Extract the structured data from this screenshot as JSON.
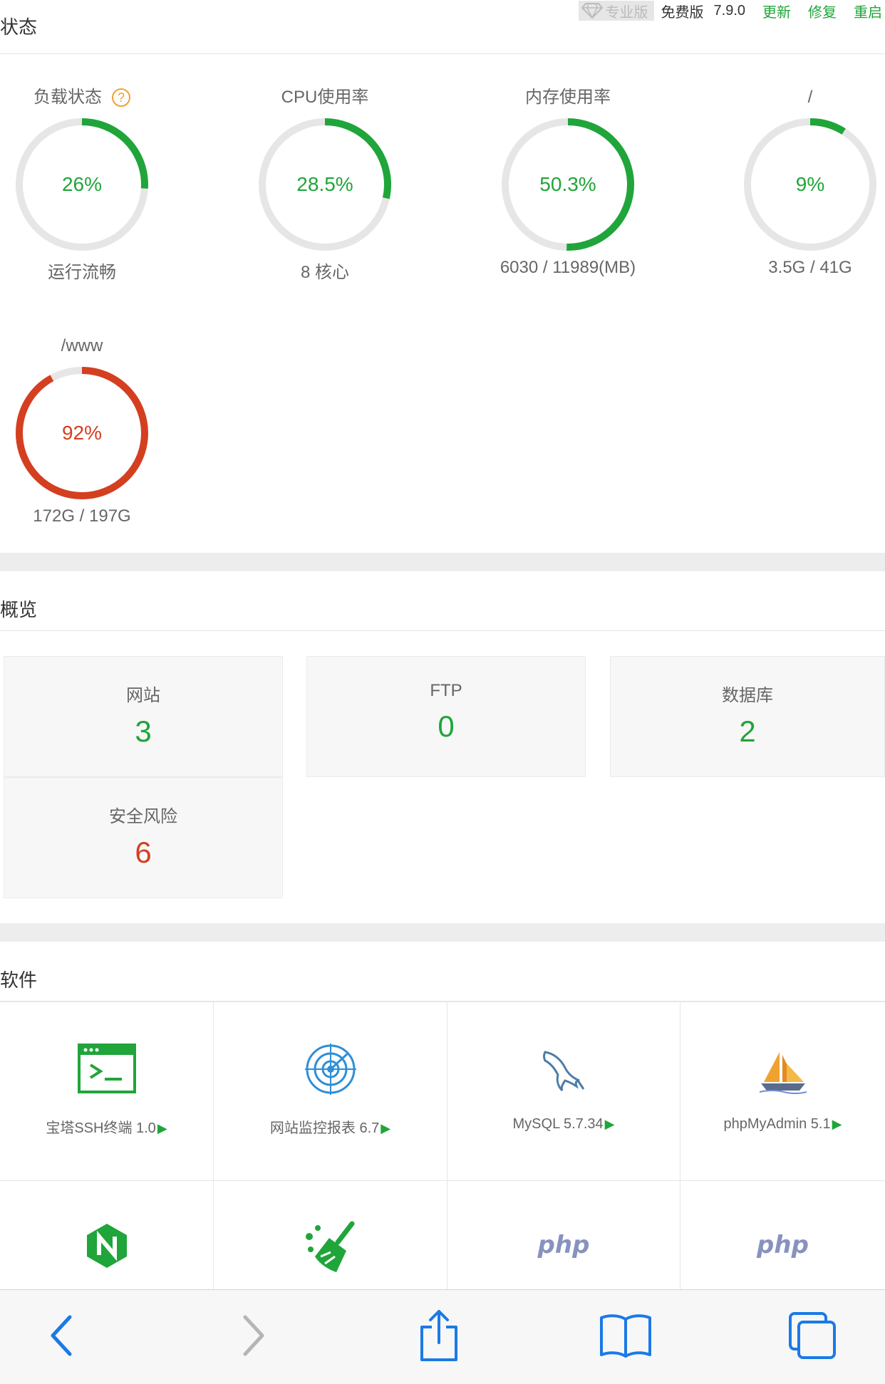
{
  "header": {
    "title": "状态",
    "pro_label": "专业版",
    "edition": "免费版",
    "version": "7.9.0",
    "links": [
      "更新",
      "修复",
      "重启"
    ]
  },
  "gauges": [
    {
      "title": "负载状态",
      "value": "26%",
      "percent": 26,
      "sub": "运行流畅",
      "color": "#20a53a",
      "help": "?"
    },
    {
      "title": "CPU使用率",
      "value": "28.5%",
      "percent": 28.5,
      "sub": "8 核心",
      "color": "#20a53a"
    },
    {
      "title": "内存使用率",
      "value": "50.3%",
      "percent": 50.3,
      "sub": "6030 / 11989(MB)",
      "color": "#20a53a"
    },
    {
      "title": "/",
      "value": "9%",
      "percent": 9,
      "sub": "3.5G / 41G",
      "color": "#20a53a"
    },
    {
      "title": "/www",
      "value": "92%",
      "percent": 92,
      "sub": "172G / 197G",
      "color": "#d43f20"
    }
  ],
  "overview": {
    "title": "概览",
    "cards": [
      {
        "label": "网站",
        "value": "3",
        "color": "#20a53a"
      },
      {
        "label": "FTP",
        "value": "0",
        "color": "#20a53a"
      },
      {
        "label": "数据库",
        "value": "2",
        "color": "#20a53a"
      },
      {
        "label": "安全风险",
        "value": "6",
        "color": "#d43f20"
      }
    ]
  },
  "software": {
    "title": "软件",
    "items": [
      {
        "name": "宝塔SSH终端 1.0",
        "icon": "terminal-icon"
      },
      {
        "name": "网站监控报表 6.7",
        "icon": "monitor-radar-icon"
      },
      {
        "name": "MySQL 5.7.34",
        "icon": "mysql-dolphin-icon"
      },
      {
        "name": "phpMyAdmin 5.1",
        "icon": "phpmyadmin-sailboat-icon"
      },
      {
        "name": "",
        "icon": "nginx-icon"
      },
      {
        "name": "",
        "icon": "cleanup-broom-icon"
      },
      {
        "name": "",
        "icon": "php-icon",
        "logo_text": "php"
      },
      {
        "name": "",
        "icon": "php-icon",
        "logo_text": "php"
      }
    ],
    "arrow": "▶"
  },
  "toolbar": {
    "icons": [
      "back-icon",
      "forward-icon",
      "share-icon",
      "bookmarks-icon",
      "tabs-icon"
    ]
  }
}
